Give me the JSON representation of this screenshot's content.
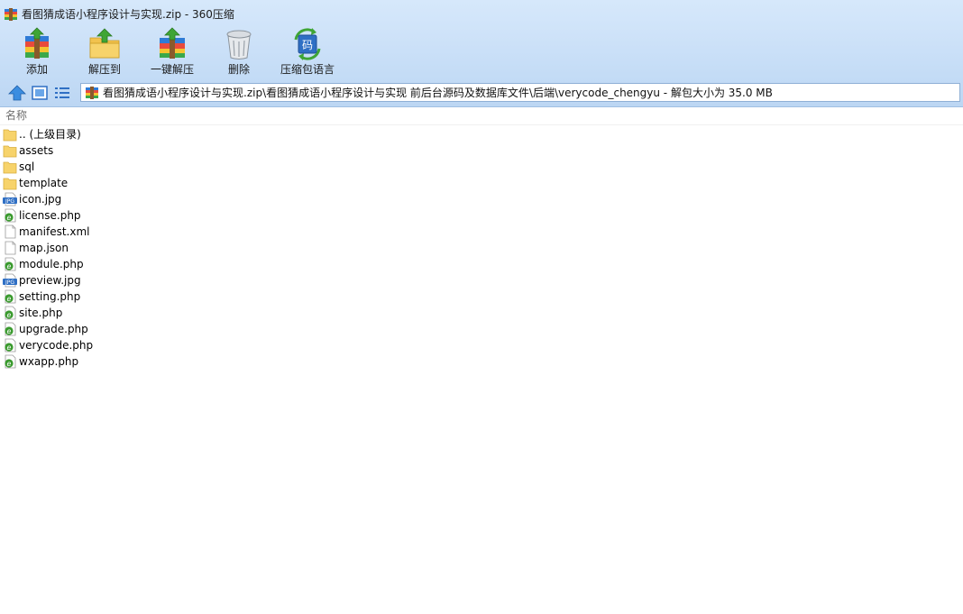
{
  "window": {
    "title": "看图猜成语小程序设计与实现.zip - 360压缩"
  },
  "toolbar": {
    "add_label": "添加",
    "extract_to_label": "解压到",
    "one_click_extract_label": "一键解压",
    "delete_label": "删除",
    "language_label": "压缩包语言"
  },
  "address": {
    "path": "看图猜成语小程序设计与实现.zip\\看图猜成语小程序设计与实现 前后台源码及数据库文件\\后端\\verycode_chengyu - 解包大小为 35.0 MB"
  },
  "list": {
    "column_name": "名称",
    "items": [
      {
        "name": ".. (上级目录)",
        "icon": "folder-icon"
      },
      {
        "name": "assets",
        "icon": "folder-icon"
      },
      {
        "name": "sql",
        "icon": "folder-icon"
      },
      {
        "name": "template",
        "icon": "folder-icon"
      },
      {
        "name": "icon.jpg",
        "icon": "jpg-file-icon"
      },
      {
        "name": "license.php",
        "icon": "php-file-icon"
      },
      {
        "name": "manifest.xml",
        "icon": "blank-file-icon"
      },
      {
        "name": "map.json",
        "icon": "blank-file-icon"
      },
      {
        "name": "module.php",
        "icon": "php-file-icon"
      },
      {
        "name": "preview.jpg",
        "icon": "jpg-file-icon"
      },
      {
        "name": "setting.php",
        "icon": "php-file-icon"
      },
      {
        "name": "site.php",
        "icon": "php-file-icon"
      },
      {
        "name": "upgrade.php",
        "icon": "php-file-icon"
      },
      {
        "name": "verycode.php",
        "icon": "php-file-icon"
      },
      {
        "name": "wxapp.php",
        "icon": "php-file-icon"
      }
    ]
  },
  "colors": {
    "chrome_top": "#d6e8fb",
    "chrome_bottom": "#bcd6f3",
    "address_border": "#8fb0d6",
    "folder_yellow": "#f7d36b",
    "php_green": "#3a9a2e",
    "jpg_blue": "#2f6fc4"
  }
}
